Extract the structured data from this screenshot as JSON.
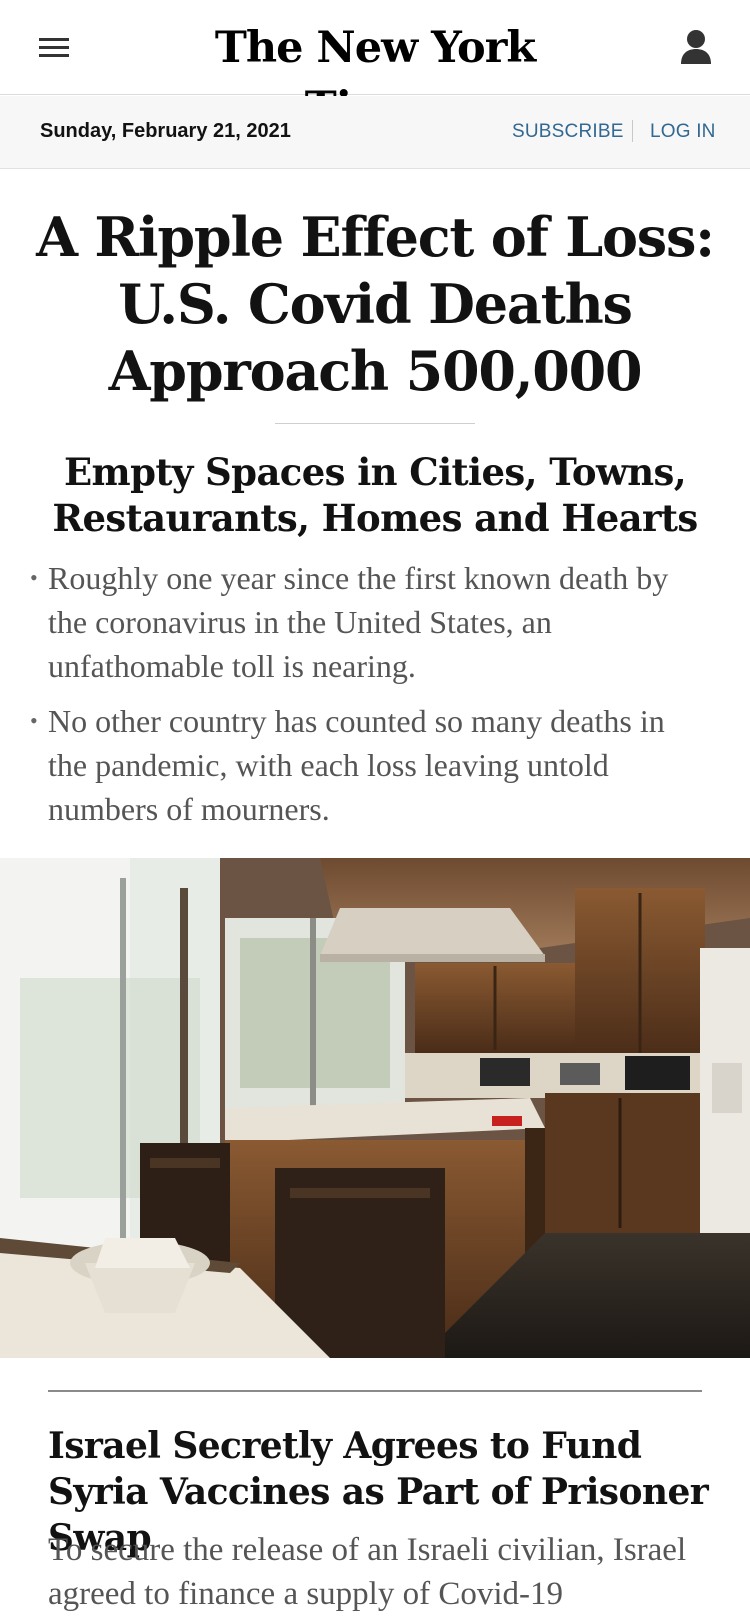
{
  "header": {
    "logo_text": "The New York Times",
    "menu_icon": "hamburger-menu-icon",
    "account_icon": "user-account-icon"
  },
  "datebar": {
    "date": "Sunday, February 21, 2021",
    "subscribe_label": "SUBSCRIBE",
    "login_label": "LOG IN",
    "link_color": "#326891"
  },
  "lead_story": {
    "headline": "A Ripple Effect of Loss: U.S. Covid Deaths Approach 500,000",
    "subheadline": "Empty Spaces in Cities, Towns, Restaurants, Homes and Hearts",
    "bullets": [
      "Roughly one year since the first known death by the coronavirus in the United States, an unfathomable toll is nearing.",
      "No other country has counted so many deaths in the pandemic, with each loss leaving untold numbers of mourners."
    ]
  },
  "secondary_story": {
    "headline": "Israel Secretly Agrees to Fund Syria Vaccines as Part of Prisoner Swap",
    "summary": "To secure the release of an Israeli civilian, Israel agreed to finance a supply of Covid-19"
  }
}
